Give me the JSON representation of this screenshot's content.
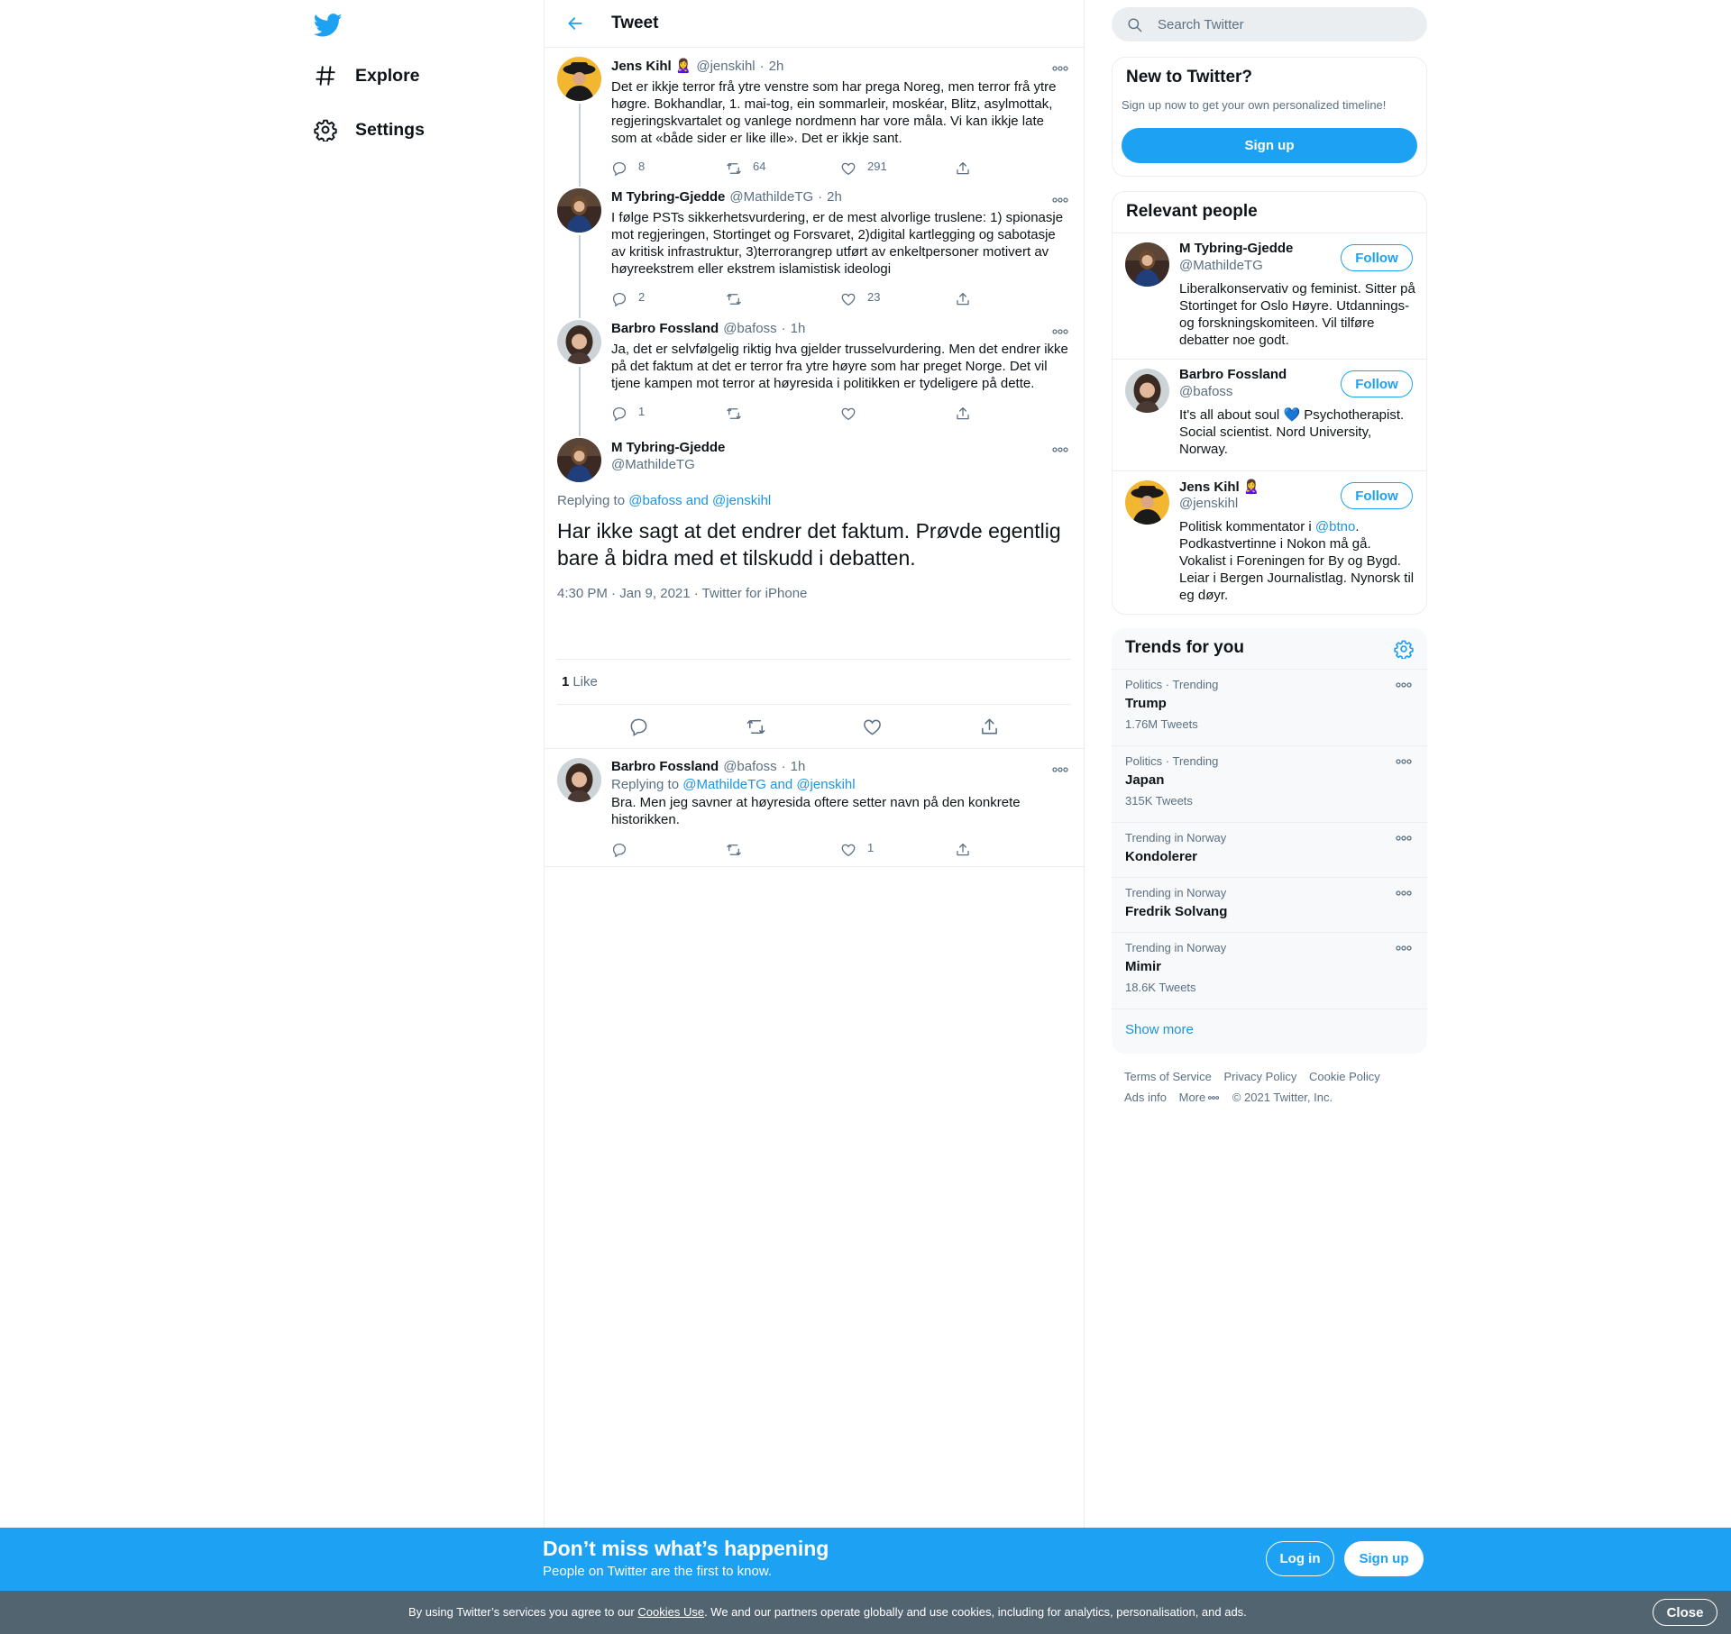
{
  "nav": {
    "logo_icon": "twitter-bird-icon",
    "items": [
      {
        "label": "Explore",
        "icon": "hashtag-icon"
      },
      {
        "label": "Settings",
        "icon": "gear-icon"
      }
    ]
  },
  "main": {
    "title": "Tweet",
    "thread": [
      {
        "name": "Jens Kihl",
        "emoji": "🙎‍♀️",
        "handle": "@jenskihl",
        "time": "2h",
        "text": "Det er ikkje terror frå ytre venstre som har prega Noreg, men terror frå ytre høgre. Bokhandlar, 1. mai-tog, ein sommarleir, moskéar, Blitz, asylmottak, regjeringskvartalet og vanlege nordmenn har vore måla. Vi kan ikkje late som at «både sider er like ille». Det er ikkje sant.",
        "replies": "8",
        "retweets": "64",
        "likes": "291"
      },
      {
        "name": "M Tybring-Gjedde",
        "handle": "@MathildeTG",
        "time": "2h",
        "text": "I følge PSTs sikkerhetsvurdering, er de mest alvorlige truslene: 1) spionasje mot regjeringen, Stortinget og Forsvaret, 2)digital kartlegging og sabotasje av kritisk infrastruktur, 3)terrorangrep utført av enkeltpersoner motivert av høyreekstrem eller ekstrem islamistisk ideologi",
        "replies": "2",
        "retweets": "",
        "likes": "23"
      },
      {
        "name": "Barbro Fossland",
        "handle": "@bafoss",
        "time": "1h",
        "text": "Ja, det er selvfølgelig riktig hva gjelder trusselvurdering. Men det endrer ikke på det faktum at det er terror fra ytre høyre som har preget Norge. Det vil tjene kampen mot terror at høyresida i politikken er tydeligere på dette.",
        "replies": "1",
        "retweets": "",
        "likes": ""
      }
    ],
    "focus": {
      "name": "M Tybring-Gjedde",
      "handle": "@MathildeTG",
      "replying_prefix": "Replying to ",
      "replying_to": "@bafoss and @jenskihl",
      "text": "Har ikke sagt at det endrer det faktum. Prøvde egentlig bare å bidra med et tilskudd i debatten.",
      "timestamp": "4:30 PM · Jan 9, 2021",
      "source": "Twitter for iPhone",
      "like_count": "1",
      "like_label": "Like"
    },
    "reply": {
      "name": "Barbro Fossland",
      "handle": "@bafoss",
      "time": "1h",
      "replying_prefix": "Replying to ",
      "replying_to": "@MathildeTG and @jenskihl",
      "text": "Bra. Men jeg savner at høyresida oftere setter navn på den konkrete historikken.",
      "replies": "",
      "retweets": "",
      "likes": "1"
    },
    "separator": "·"
  },
  "right": {
    "search_placeholder": "Search Twitter",
    "new_to_twitter": {
      "title": "New to Twitter?",
      "subtitle": "Sign up now to get your own personalized timeline!",
      "button": "Sign up"
    },
    "relevant_people": {
      "title": "Relevant people",
      "follow_label": "Follow",
      "people": [
        {
          "name": "M Tybring-Gjedde",
          "handle": "@MathildeTG",
          "bio": "Liberalkonservativ og feminist. Sitter på Stortinget for Oslo Høyre. Utdannings- og forskningskomiteen. Vil tilføre debatter noe godt."
        },
        {
          "name": "Barbro Fossland",
          "handle": "@bafoss",
          "bio_before": "It's all about soul ",
          "bio_emoji": "💙",
          "bio_after": " Psychotherapist. Social scientist. Nord University, Norway."
        },
        {
          "name": "Jens Kihl",
          "emoji": "🙎‍♀️",
          "handle": "@jenskihl",
          "bio_before": "Politisk kommentator i ",
          "bio_link": "@btno",
          "bio_after": ". Podkastvertinne i Nokon må gå. Vokalist i Foreningen for By og Bygd. Leiar i Bergen Journalistlag. Nynorsk til eg døyr."
        }
      ]
    },
    "trends": {
      "title": "Trends for you",
      "items": [
        {
          "meta": "Politics · Trending",
          "name": "Trump",
          "count": "1.76M Tweets"
        },
        {
          "meta": "Politics · Trending",
          "name": "Japan",
          "count": "315K Tweets"
        },
        {
          "meta": "Trending in Norway",
          "name": "Kondolerer",
          "count": ""
        },
        {
          "meta": "Trending in Norway",
          "name": "Fredrik Solvang",
          "count": ""
        },
        {
          "meta": "Trending in Norway",
          "name": "Mimir",
          "count": "18.6K Tweets"
        }
      ],
      "show_more": "Show more"
    },
    "footer": {
      "links": [
        "Terms of Service",
        "Privacy Policy",
        "Cookie Policy",
        "Ads info",
        "More"
      ],
      "copyright": "© 2021 Twitter, Inc."
    }
  },
  "bottom_bar": {
    "title": "Don’t miss what’s happening",
    "subtitle": "People on Twitter are the first to know.",
    "login": "Log in",
    "signup": "Sign up"
  },
  "cookie_bar": {
    "text_before": "By using Twitter’s services you agree to our ",
    "link": "Cookies Use",
    "text_after": ". We and our partners operate globally and use cookies, including for analytics, personalisation, and ads.",
    "close": "Close"
  },
  "colors": {
    "accent": "#1da1f2",
    "link": "#1b95e0",
    "muted": "#5b7083",
    "border": "#ebeef0",
    "cookie_bg": "#536471"
  }
}
